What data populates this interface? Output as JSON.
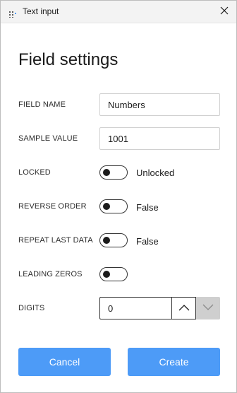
{
  "window": {
    "title": "Text input",
    "icon": "grid-dots-icon",
    "close_icon": "close-icon"
  },
  "form": {
    "heading": "Field settings",
    "field_name": {
      "label": "FIELD NAME",
      "value": "Numbers"
    },
    "sample_value": {
      "label": "SAMPLE VALUE",
      "value": "1001"
    },
    "locked": {
      "label": "LOCKED",
      "on": false,
      "state_text": "Unlocked"
    },
    "reverse_order": {
      "label": "REVERSE ORDER",
      "on": false,
      "state_text": "False"
    },
    "repeat_last_data": {
      "label": "REPEAT LAST DATA",
      "on": false,
      "state_text": "False"
    },
    "leading_zeros": {
      "label": "LEADING ZEROS",
      "on": false
    },
    "digits": {
      "label": "DIGITS",
      "value": "0",
      "up_icon": "chevron-up-icon",
      "down_icon": "chevron-down-icon",
      "down_disabled": true
    }
  },
  "actions": {
    "cancel_label": "Cancel",
    "create_label": "Create"
  },
  "colors": {
    "primary_button": "#4d9bf7",
    "titlebar": "#f3f3f3",
    "disabled_stepper": "#cfcfcf"
  }
}
